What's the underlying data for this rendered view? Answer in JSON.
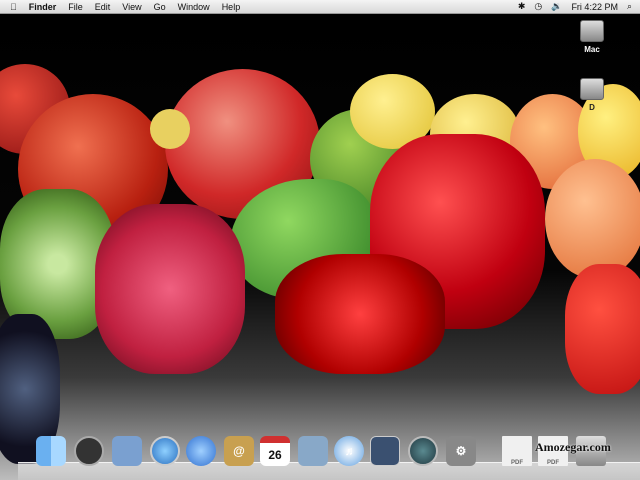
{
  "menubar": {
    "apple_icon": "apple-icon",
    "app": "Finder",
    "items": [
      "File",
      "Edit",
      "View",
      "Go",
      "Window",
      "Help"
    ],
    "status_icons": [
      "bluetooth-icon",
      "time-machine-icon",
      "volume-icon"
    ],
    "clock": "Fri 4:22 PM",
    "spotlight_icon": "search-icon"
  },
  "desktop": {
    "drives": [
      {
        "label": "Mac"
      },
      {
        "label": "D"
      }
    ]
  },
  "dock": {
    "items": [
      {
        "name": "Finder",
        "icon": "finder-icon"
      },
      {
        "name": "Dashboard",
        "icon": "dashboard-icon"
      },
      {
        "name": "Mail",
        "icon": "mail-icon"
      },
      {
        "name": "Safari",
        "icon": "safari-icon"
      },
      {
        "name": "iChat",
        "icon": "ichat-icon"
      },
      {
        "name": "Address Book",
        "icon": "address-book-icon"
      },
      {
        "name": "iCal",
        "icon": "calendar-icon",
        "badge": "26"
      },
      {
        "name": "iPhoto",
        "icon": "iphoto-icon"
      },
      {
        "name": "iTunes",
        "icon": "itunes-icon"
      },
      {
        "name": "Spaces",
        "icon": "spaces-icon"
      },
      {
        "name": "Time Machine",
        "icon": "time-machine-icon"
      },
      {
        "name": "System Preferences",
        "icon": "system-preferences-icon"
      },
      {
        "name": "PDF",
        "icon": "pdf-document-icon",
        "badge": "PDF"
      },
      {
        "name": "PDF",
        "icon": "pdf-document-icon",
        "badge": "PDF"
      },
      {
        "name": "Trash",
        "icon": "trash-icon"
      }
    ]
  },
  "watermark": "Amozegar.com",
  "colors": {
    "menubar": "#e6e6e6",
    "wallpaper_bg": "#000000"
  }
}
